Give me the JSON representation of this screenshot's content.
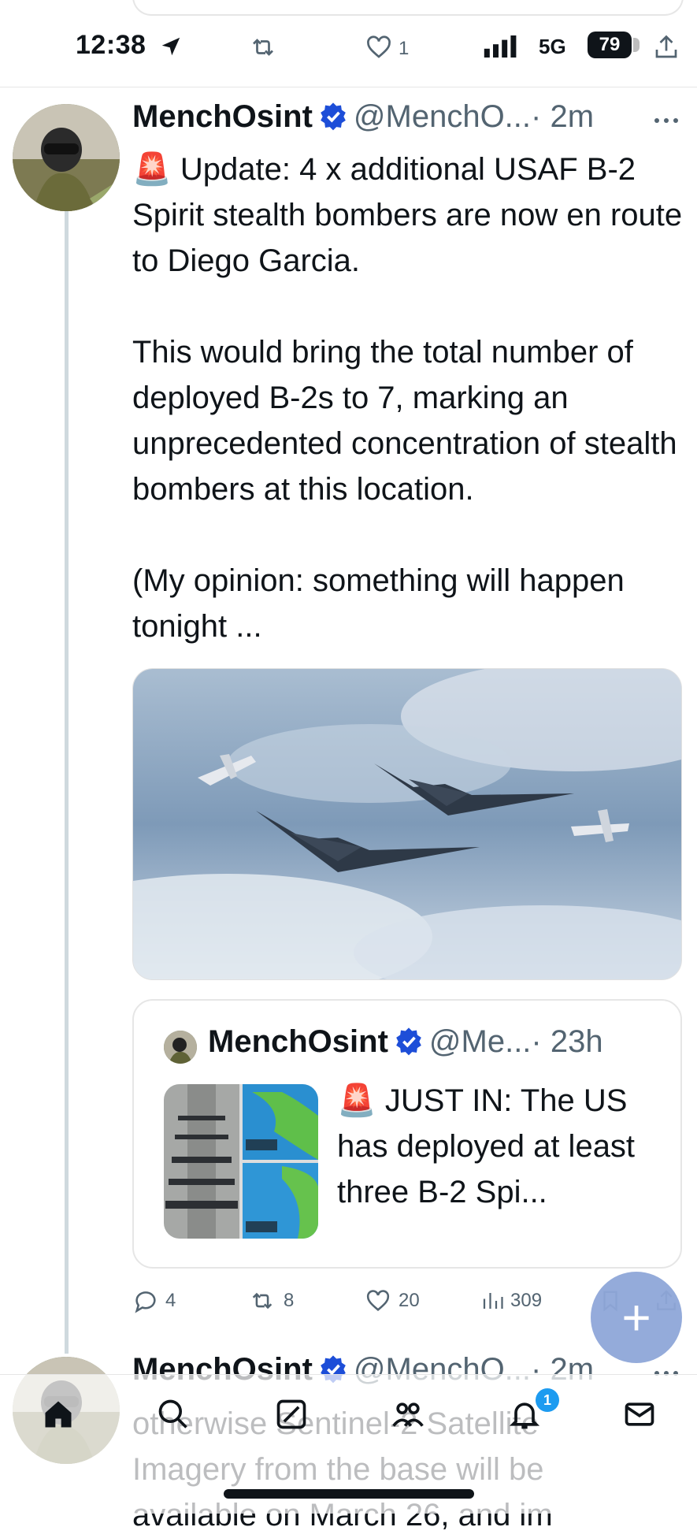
{
  "status": {
    "time": "12:38",
    "retweet_count": "",
    "like_count": "1",
    "network": "5G",
    "battery": "79"
  },
  "tweet": {
    "author_name": "MenchOsint",
    "handle": "@MenchO...",
    "time_ago": "· 2m",
    "text": "🚨 Update: 4 x additional USAF B-2 Spirit stealth bombers are now en route to Diego Garcia.\n\nThis would bring the total number of deployed B-2s to 7, marking an unprecedented concentration of stealth bombers at this location.\n\n(My opinion: something will happen tonight ...",
    "quote": {
      "author_name": "MenchOsint",
      "handle": "@Me...",
      "time_ago": "· 23h",
      "text": "🚨 JUST IN: The US has deployed at least three B-2 Spi..."
    },
    "actions": {
      "replies": "4",
      "retweets": "8",
      "likes": "20",
      "views": "309"
    }
  },
  "tweet2": {
    "author_name": "MenchOsint",
    "handle": "@MenchO...",
    "time_ago": "· 2m",
    "text": "otherwise Sentinel-2 Satellite\nImagery from the base will be\navailable on March 26, and im"
  },
  "tabbar": {
    "notification_count": "1"
  },
  "colors": {
    "accent": "#1d9bf0",
    "verified": "#1d4ed8",
    "fab": "#8fa7d9",
    "muted": "#536471"
  }
}
